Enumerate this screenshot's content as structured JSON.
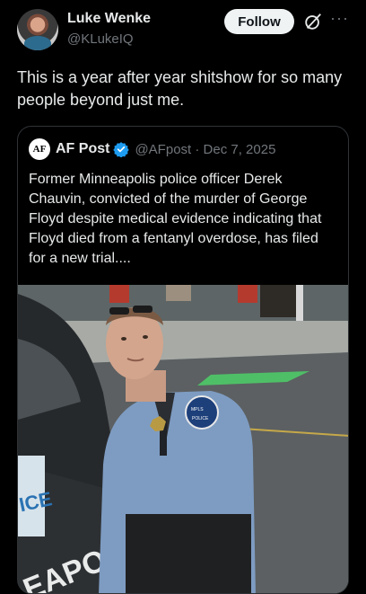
{
  "author": {
    "name": "Luke Wenke",
    "handle": "@KLukeIQ"
  },
  "actions": {
    "follow_label": "Follow"
  },
  "post": {
    "text": "This is a year after year shitshow for so many people beyond just me."
  },
  "quoted": {
    "logo_text": "AF",
    "name": "AF Post",
    "meta": "@AFpost · Dec 7, 2025",
    "text": "Former Minneapolis police officer Derek Chauvin, convicted of the murder of George Floyd despite medical evidence indicating that Floyd died from a fentanyl overdose, has filed for a new trial....",
    "media": {
      "patch_text": "MINNEAPOLIS",
      "patch_sub": "POLICE",
      "car_text": "EAPOLIS",
      "plate_text": "ICE"
    }
  },
  "icons": {
    "verified": "verified-badge-icon",
    "grok": "grok-icon",
    "more": "more-icon"
  },
  "colors": {
    "background": "#000000",
    "text": "#e7e9ea",
    "secondary": "#71767b",
    "verified": "#1d9bf0",
    "border": "#2f3336"
  }
}
